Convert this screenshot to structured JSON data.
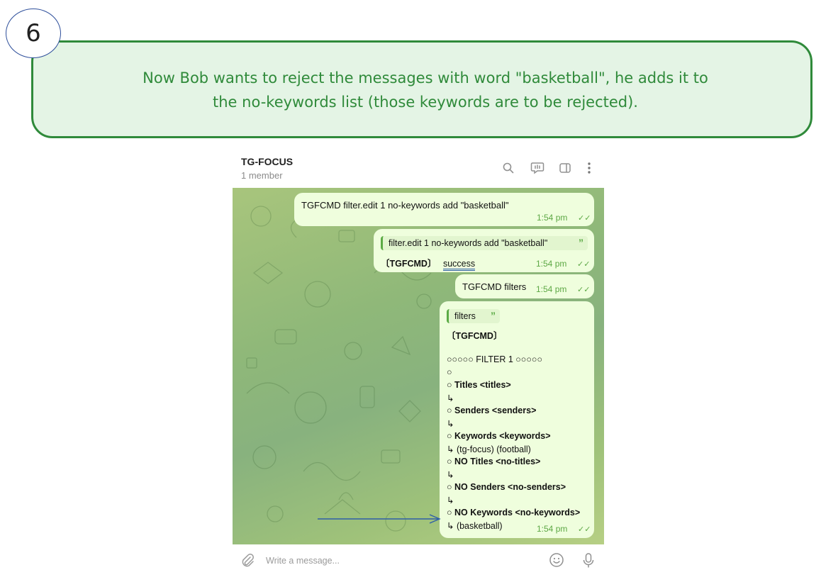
{
  "annotation": {
    "step_number": "6",
    "line1": "Now Bob wants to reject the messages with word \"basketball\", he adds it to",
    "line2": "the no-keywords list (those keywords are to be rejected)."
  },
  "header": {
    "title": "TG-FOCUS",
    "subtitle": "1 member",
    "icons": [
      "search-icon",
      "video-chat-icon",
      "sidebar-toggle-icon",
      "more-vert-icon"
    ]
  },
  "messages": {
    "m1": {
      "text": "TGFCMD  filter.edit  1  no-keywords  add  \"basketball\"",
      "time": "1:54 pm"
    },
    "m2": {
      "quote": "filter.edit 1 no-keywords add \"basketball\"",
      "quote_mark": "”",
      "prefix": "〔TGFCMD〕",
      "status": "success",
      "time": "1:54 pm"
    },
    "m3": {
      "text": "TGFCMD filters",
      "time": "1:54 pm"
    },
    "m4": {
      "quote": "filters",
      "quote_mark": "”",
      "prefix": "〔TGFCMD〕",
      "filter_header": "○○○○○ FILTER 1 ○○○○○",
      "sep": "○",
      "titles": "○ Titles <titles>",
      "titles_val": "↳",
      "senders": "○ Senders <senders>",
      "senders_val": "↳",
      "keywords": "○ Keywords <keywords>",
      "keywords_val": "↳ (tg-focus)  (football)",
      "no_titles": "○ NO Titles <no-titles>",
      "no_titles_val": "↳",
      "no_senders": "○ NO Senders <no-senders>",
      "no_senders_val": "↳",
      "no_keywords": "○ NO Keywords <no-keywords>",
      "no_keywords_val": "↳ (basketball)",
      "time": "1:54 pm"
    }
  },
  "input": {
    "placeholder": "Write a message..."
  },
  "colors": {
    "annotation_green": "#2f8a3a",
    "annotation_bg": "#e4f4e5",
    "bubble": "#effedd",
    "accent": "#5da845",
    "arrow": "#2e5ea8"
  }
}
